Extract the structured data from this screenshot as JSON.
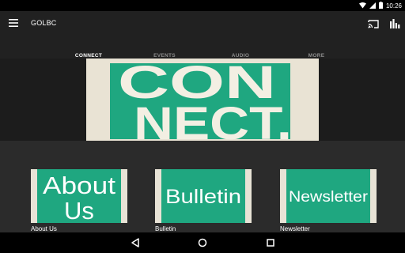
{
  "status_bar": {
    "time": "10:26"
  },
  "app_bar": {
    "title": "GOLBC"
  },
  "tabs": [
    {
      "label": "CONNECT",
      "active": true
    },
    {
      "label": "EVENTS",
      "active": false
    },
    {
      "label": "AUDIO",
      "active": false
    },
    {
      "label": "MORE",
      "active": false
    }
  ],
  "hero": {
    "line1": "CON",
    "line2": "NECT."
  },
  "cards": [
    {
      "art_line1": "About",
      "art_line2": "Us",
      "label": "About Us"
    },
    {
      "art_line1": "Bulletin",
      "art_line2": "",
      "label": "Bulletin"
    },
    {
      "art_line1": "Newsletter",
      "art_line2": "",
      "label": "Newsletter"
    }
  ],
  "colors": {
    "accent_green": "#1fa780",
    "paper": "#e9e3d4",
    "app_bar": "#212121",
    "background": "#2b2b2b"
  },
  "icons": [
    "menu-icon",
    "cast-icon",
    "bar-chart-icon",
    "wifi-icon",
    "signal-icon",
    "battery-icon",
    "back-icon",
    "home-icon",
    "recents-icon"
  ]
}
